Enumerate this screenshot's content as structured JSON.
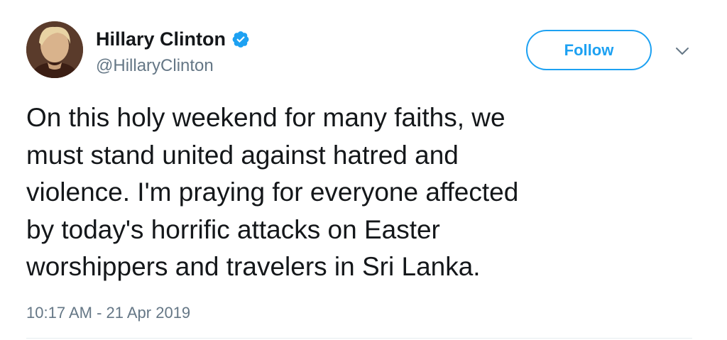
{
  "author": {
    "display_name": "Hillary Clinton",
    "handle": "@HillaryClinton",
    "verified": true,
    "avatar_icon": "profile-photo"
  },
  "actions": {
    "follow_label": "Follow",
    "more_icon": "chevron-down-icon"
  },
  "tweet": {
    "text_lines": [
      "On this holy weekend for many faiths, we",
      "must stand united against hatred and",
      "violence. I'm praying for everyone affected",
      "by today's horrific attacks on Easter",
      "worshippers and travelers in Sri Lanka."
    ],
    "timestamp": "10:17 AM - 21 Apr 2019"
  },
  "colors": {
    "accent": "#1da1f2",
    "text_primary": "#14171a",
    "text_secondary": "#657786",
    "divider": "#e6ecf0"
  }
}
